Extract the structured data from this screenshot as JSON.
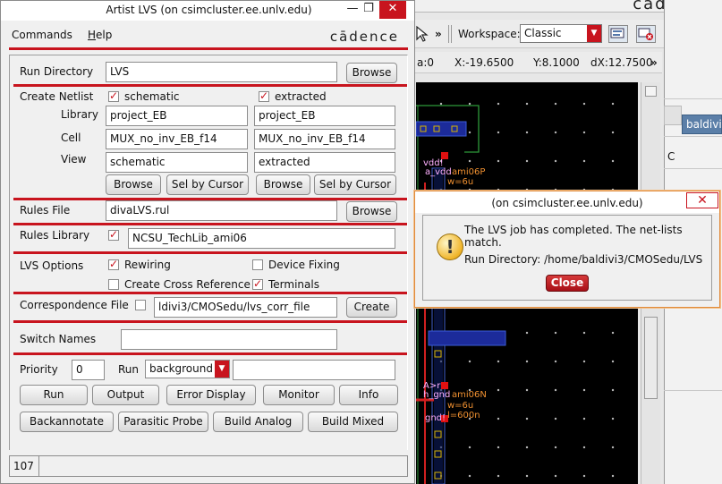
{
  "lvs_window": {
    "title": "Artist LVS (on csimcluster.ee.unlv.edu)",
    "window_buttons": {
      "minimize": "—",
      "maximize": "❐",
      "close": "✕"
    },
    "menu": {
      "commands": "Commands",
      "help_first": "H",
      "help_rest": "elp"
    },
    "brand": "cādence",
    "run_directory": {
      "label": "Run Directory",
      "value": "LVS",
      "browse": "Browse"
    },
    "netlist": {
      "label": "Create Netlist",
      "schematic_label": "schematic",
      "extracted_label": "extracted",
      "library_label": "Library",
      "cell_label": "Cell",
      "view_label": "View",
      "left": {
        "library": "project_EB",
        "cell": "MUX_no_inv_EB_f14",
        "view": "schematic"
      },
      "right": {
        "library": "project_EB",
        "cell": "MUX_no_inv_EB_f14",
        "view": "extracted"
      },
      "browse": "Browse",
      "sel_by_cursor": "Sel by Cursor"
    },
    "rules_file": {
      "label": "Rules File",
      "value": "divaLVS.rul",
      "browse": "Browse"
    },
    "rules_library": {
      "label": "Rules Library",
      "value": "NCSU_TechLib_ami06"
    },
    "lvs_options": {
      "label": "LVS Options",
      "rewiring": "Rewiring",
      "device_fixing": "Device Fixing",
      "cross_reference": "Create Cross Reference",
      "terminals": "Terminals"
    },
    "correspondence": {
      "label": "Correspondence File",
      "value": "ldivi3/CMOSedu/lvs_corr_file",
      "create": "Create"
    },
    "switch_names": {
      "label": "Switch Names",
      "value": ""
    },
    "priority": {
      "label": "Priority",
      "value": "0"
    },
    "run_mode": {
      "label": "Run",
      "value": "background",
      "extra": ""
    },
    "buttons_row1": [
      "Run",
      "Output",
      "Error Display",
      "Monitor",
      "Info"
    ],
    "buttons_row2": [
      "Backannotate",
      "Parasitic Probe",
      "Build Analog",
      "Build Mixed"
    ],
    "status_number": "107"
  },
  "background_window": {
    "brand": "cādence",
    "workspace_label": "Workspace:",
    "workspace_value": "Classic",
    "coords": {
      "prefix": "a:0",
      "x": "X:-19.6500",
      "y": "Y:8.1000",
      "dx": "dX:12.7500"
    },
    "chevron": "»",
    "column_header": "baldivi",
    "side_char": "C",
    "layout_labels": [
      "vdd!",
      "a_vdd",
      "ami06P",
      "w=6u",
      "A>r",
      "h_gnd",
      "ami06N",
      "w=6u",
      "gnd!",
      "l=600n"
    ]
  },
  "dialog": {
    "title": "(on csimcluster.ee.unlv.edu)",
    "message": "The LVS job has completed. The net-lists match.",
    "run_directory": "Run Directory: /home/baldivi3/CMOSedu/LVS",
    "close_button": "Close",
    "close_icon": "✕"
  }
}
